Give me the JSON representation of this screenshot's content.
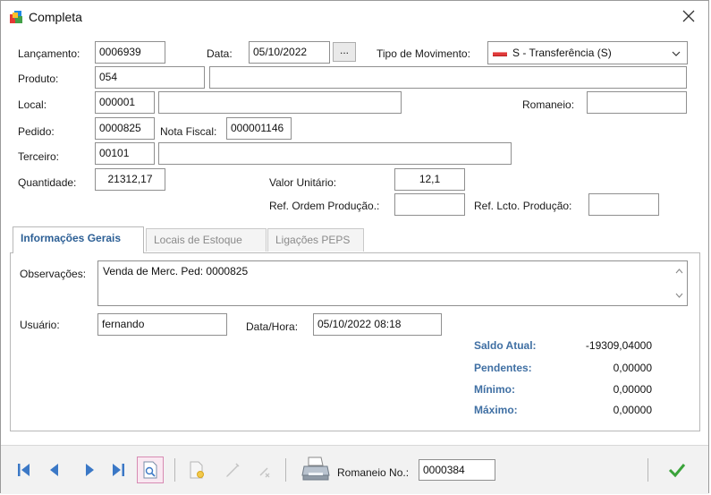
{
  "window": {
    "title": "Completa"
  },
  "form": {
    "lancamento": {
      "label": "Lançamento:",
      "value": "0006939"
    },
    "data": {
      "label": "Data:",
      "value": "05/10/2022",
      "button": "..."
    },
    "tipo_movimento": {
      "label": "Tipo de Movimento:",
      "value": "S - Transferência (S)",
      "flag_color": "#e03a3a"
    },
    "produto": {
      "label": "Produto:",
      "code": "054",
      "description": ""
    },
    "local": {
      "label": "Local:",
      "code": "000001",
      "description": ""
    },
    "romaneio": {
      "label": "Romaneio:",
      "value": ""
    },
    "pedido": {
      "label": "Pedido:",
      "value": "0000825"
    },
    "nota_fiscal": {
      "label": "Nota Fiscal:",
      "value": "000001146"
    },
    "terceiro": {
      "label": "Terceiro:",
      "code": "00101",
      "description": ""
    },
    "quantidade": {
      "label": "Quantidade:",
      "value": "21312,17"
    },
    "valor_unitario": {
      "label": "Valor Unitário:",
      "value": "12,1"
    },
    "ref_ordem_producao": {
      "label": "Ref. Ordem Produção.:",
      "value": ""
    },
    "ref_lcto_producao": {
      "label": "Ref. Lcto. Produção:",
      "value": ""
    }
  },
  "tabs": [
    {
      "label": "Informações Gerais",
      "active": true
    },
    {
      "label": "Locais de Estoque",
      "active": false
    },
    {
      "label": "Ligações PEPS",
      "active": false
    }
  ],
  "info": {
    "observacoes": {
      "label": "Observações:",
      "value": "Venda de Merc. Ped: 0000825"
    },
    "usuario": {
      "label": "Usuário:",
      "value": "fernando"
    },
    "data_hora": {
      "label": "Data/Hora:",
      "value": "05/10/2022 08:18"
    },
    "stats": [
      {
        "label": "Saldo Atual:",
        "value": "-19309,04000"
      },
      {
        "label": "Pendentes:",
        "value": "0,00000"
      },
      {
        "label": "Mínimo:",
        "value": "0,00000"
      },
      {
        "label": "Máximo:",
        "value": "0,00000"
      }
    ]
  },
  "toolbar": {
    "romaneio_no": {
      "label": "Romaneio No.:",
      "value": "0000384"
    },
    "colors": {
      "nav": "#3b78c6",
      "confirm": "#3aa33a",
      "stat_label": "#3f6fa3",
      "active_tab": "#2c5f95"
    }
  }
}
